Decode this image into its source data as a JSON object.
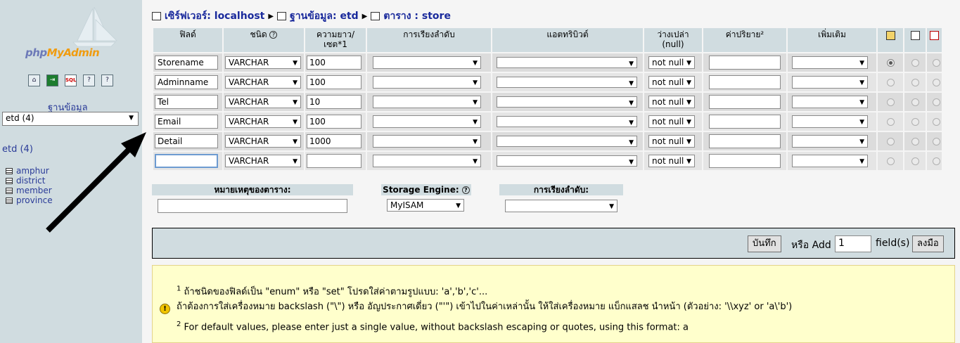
{
  "sidebar": {
    "logo": {
      "php": "php",
      "my": "My",
      "admin": "Admin"
    },
    "tool_icons": [
      "home-icon",
      "exit-icon",
      "sql-icon",
      "query-window-icon",
      "docs-icon"
    ],
    "database_label": "ฐานข้อมูล",
    "database_selected": "etd (4)",
    "database_link": "etd (4)",
    "tables": [
      "amphur",
      "district",
      "member",
      "province"
    ]
  },
  "breadcrumb": {
    "server": "เซิร์ฟเวอร์: localhost",
    "database": "ฐานข้อมูล: etd",
    "table": "ตาราง : store"
  },
  "fields_table": {
    "headers": {
      "field": "ฟิลด์",
      "type": "ชนิด",
      "length_1": "ความยาว/",
      "length_2": "เซต*1",
      "collation": "การเรียงลำดับ",
      "attributes": "แอตทริบิวต์",
      "null_1": "ว่างเปล่า",
      "null_2": "(null)",
      "default": "ค่าปริยาย²",
      "extra": "เพิ่มเติม"
    },
    "header_icons": [
      "primary-key-icon",
      "index-icon",
      "unique-icon"
    ],
    "rows": [
      {
        "name": "Storename",
        "type": "VARCHAR",
        "length": "100",
        "null": "not null"
      },
      {
        "name": "Adminname",
        "type": "VARCHAR",
        "length": "100",
        "null": "not null"
      },
      {
        "name": "Tel",
        "type": "VARCHAR",
        "length": "10",
        "null": "not null"
      },
      {
        "name": "Email",
        "type": "VARCHAR",
        "length": "100",
        "null": "not null"
      },
      {
        "name": "Detail",
        "type": "VARCHAR",
        "length": "1000",
        "null": "not null"
      },
      {
        "name": "",
        "type": "VARCHAR",
        "length": "",
        "null": "not null"
      }
    ]
  },
  "table_options": {
    "comment_label": "หมายเหตุของตาราง:",
    "engine_label": "Storage Engine:",
    "engine_value": "MyISAM",
    "collation_label": "การเรียงลำดับ:"
  },
  "actions": {
    "save_label": "บันทึก",
    "or_add_label": "หรือ Add",
    "add_count": "1",
    "fields_label": "field(s)",
    "go_label": "ลงมือ"
  },
  "notes": {
    "note1_num": "1",
    "note1_line1": "ถ้าชนิดของฟิลด์เป็น \"enum\" หรือ \"set\" โปรดใส่ค่าตามรูปแบบ: 'a','b','c'...",
    "note1_line2": "ถ้าต้องการใส่เครื่องหมาย backslash (\"\\\") หรือ อัญประกาศเดี่ยว (\"'\") เข้าไปในค่าเหล่านั้น ให้ใส่เครื่องหมาย แบ็กแสลช นำหน้า (ตัวอย่าง: '\\\\xyz' or 'a\\'b')",
    "note2_num": "2",
    "note2_line": "For default values, please enter just a single value, without backslash escaping or quotes, using this format: a"
  },
  "colors": {
    "sidebar_bg": "#d0dce0",
    "link": "#2a3b98",
    "note_bg": "#ffffcc"
  }
}
